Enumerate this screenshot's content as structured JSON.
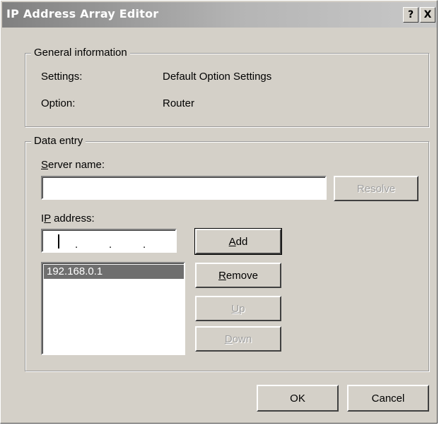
{
  "window": {
    "title": "IP Address Array Editor",
    "help_label": "?",
    "close_label": "X"
  },
  "general": {
    "legend": "General information",
    "settings_label": "Settings:",
    "settings_value": "Default Option Settings",
    "option_label": "Option:",
    "option_value": "Router"
  },
  "data_entry": {
    "legend": "Data entry",
    "server_name_label": {
      "mnemonic": "S",
      "rest": "erver name:"
    },
    "server_name_value": "",
    "resolve_label": "Resolve",
    "ip_label": {
      "pre": "I",
      "mnemonic": "P",
      "rest": " address:"
    },
    "ip_dots": [
      ".",
      ".",
      "."
    ],
    "add_label": {
      "mnemonic": "A",
      "rest": "dd"
    },
    "remove_label": {
      "mnemonic": "R",
      "rest": "emove"
    },
    "up_label": {
      "mnemonic": "U",
      "rest": "p"
    },
    "down_label": {
      "mnemonic": "D",
      "rest": "own"
    },
    "addresses": [
      "192.168.0.1"
    ]
  },
  "footer": {
    "ok_label": "OK",
    "cancel_label": "Cancel"
  },
  "colors": {
    "face": "#d4d0c8",
    "titlebar_inactive": "#808080",
    "selection": "#6f6f6f"
  }
}
